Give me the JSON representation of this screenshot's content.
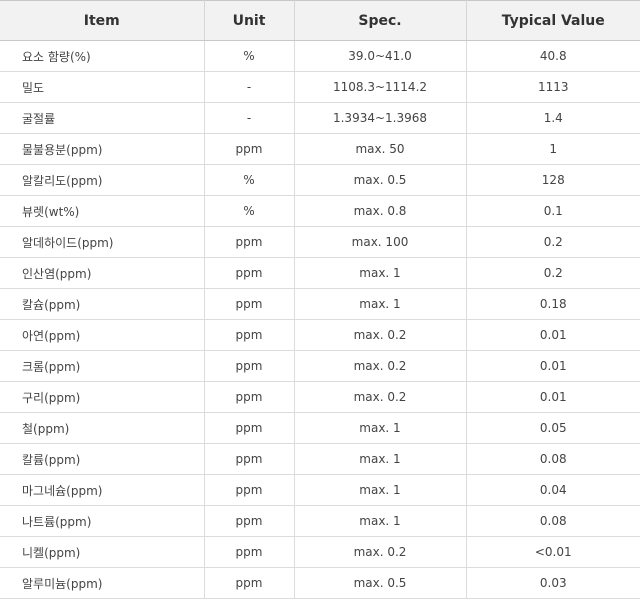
{
  "headers": {
    "item": "Item",
    "unit": "Unit",
    "spec": "Spec.",
    "value": "Typical Value"
  },
  "rows": [
    {
      "item": "요소 함량(%)",
      "unit": "%",
      "spec": "39.0~41.0",
      "value": "40.8"
    },
    {
      "item": "밀도",
      "unit": "-",
      "spec": "1108.3~1114.2",
      "value": "1113"
    },
    {
      "item": "굴절률",
      "unit": "-",
      "spec": "1.3934~1.3968",
      "value": "1.4"
    },
    {
      "item": "물불용분(ppm)",
      "unit": "ppm",
      "spec": "max. 50",
      "value": "1"
    },
    {
      "item": "알칼리도(ppm)",
      "unit": "%",
      "spec": "max. 0.5",
      "value": "128"
    },
    {
      "item": "뷰렛(wt%)",
      "unit": "%",
      "spec": "max. 0.8",
      "value": "0.1"
    },
    {
      "item": "알데하이드(ppm)",
      "unit": "ppm",
      "spec": "max. 100",
      "value": "0.2"
    },
    {
      "item": "인산염(ppm)",
      "unit": "ppm",
      "spec": "max. 1",
      "value": "0.2"
    },
    {
      "item": "칼슘(ppm)",
      "unit": "ppm",
      "spec": "max. 1",
      "value": "0.18"
    },
    {
      "item": "아연(ppm)",
      "unit": "ppm",
      "spec": "max. 0.2",
      "value": "0.01"
    },
    {
      "item": "크롬(ppm)",
      "unit": "ppm",
      "spec": "max. 0.2",
      "value": "0.01"
    },
    {
      "item": "구리(ppm)",
      "unit": "ppm",
      "spec": "max. 0.2",
      "value": "0.01"
    },
    {
      "item": "철(ppm)",
      "unit": "ppm",
      "spec": "max. 1",
      "value": "0.05"
    },
    {
      "item": "칼륨(ppm)",
      "unit": "ppm",
      "spec": "max. 1",
      "value": "0.08"
    },
    {
      "item": "마그네슘(ppm)",
      "unit": "ppm",
      "spec": "max. 1",
      "value": "0.04"
    },
    {
      "item": "나트륨(ppm)",
      "unit": "ppm",
      "spec": "max. 1",
      "value": "0.08"
    },
    {
      "item": "니켈(ppm)",
      "unit": "ppm",
      "spec": "max. 0.2",
      "value": "<0.01"
    },
    {
      "item": "알루미늄(ppm)",
      "unit": "ppm",
      "spec": "max. 0.5",
      "value": "0.03"
    }
  ]
}
